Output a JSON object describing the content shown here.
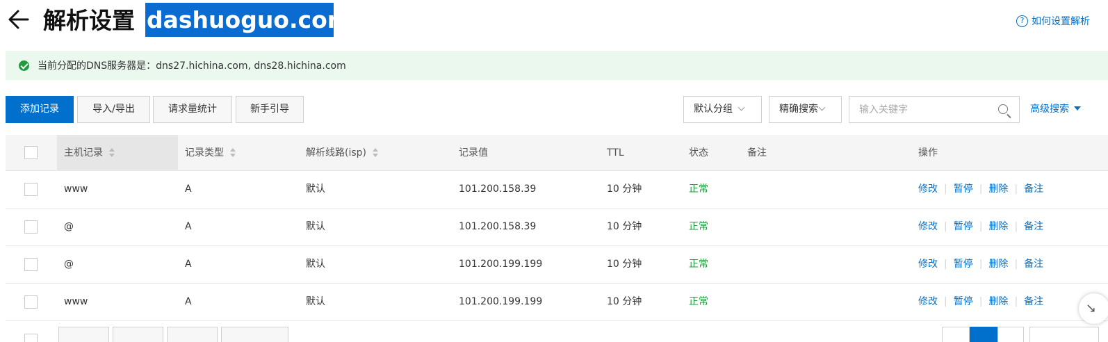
{
  "header": {
    "title": "解析设置",
    "domain": "dashuoguo.com",
    "help_link": "如何设置解析"
  },
  "dns_banner": {
    "text": "当前分配的DNS服务器是：dns27.hichina.com, dns28.hichina.com"
  },
  "toolbar": {
    "add_record": "添加记录",
    "import_export": "导入/导出",
    "request_stats": "请求量统计",
    "beginner_guide": "新手引导",
    "group_select": "默认分组",
    "search_mode": "精确搜索",
    "search_placeholder": "输入关键字",
    "advanced_search": "高级搜索"
  },
  "table": {
    "columns": {
      "host": "主机记录",
      "type": "记录类型",
      "line": "解析线路(isp)",
      "value": "记录值",
      "ttl": "TTL",
      "status": "状态",
      "remark": "备注",
      "actions": "操作"
    },
    "action_labels": {
      "edit": "修改",
      "pause": "暂停",
      "delete": "删除",
      "remark": "备注"
    },
    "rows": [
      {
        "host": "www",
        "type": "A",
        "line": "默认",
        "value": "101.200.158.39",
        "ttl": "10 分钟",
        "status": "正常",
        "remark": ""
      },
      {
        "host": "@",
        "type": "A",
        "line": "默认",
        "value": "101.200.158.39",
        "ttl": "10 分钟",
        "status": "正常",
        "remark": ""
      },
      {
        "host": "@",
        "type": "A",
        "line": "默认",
        "value": "101.200.199.199",
        "ttl": "10 分钟",
        "status": "正常",
        "remark": ""
      },
      {
        "host": "www",
        "type": "A",
        "line": "默认",
        "value": "101.200.199.199",
        "ttl": "10 分钟",
        "status": "正常",
        "remark": ""
      }
    ]
  },
  "colors": {
    "primary": "#0070cc",
    "success": "#1e9b3c",
    "banner_bg": "#eaf8ee",
    "domain_highlight": "#0a6bd0"
  }
}
